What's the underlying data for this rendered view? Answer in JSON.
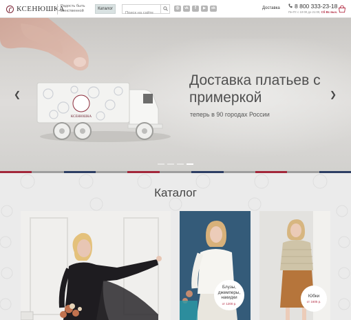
{
  "header": {
    "logo_text": "КСЕНЮШКА",
    "tagline": "Радость быть женственной",
    "catalog_label": "Каталог",
    "search_placeholder": "Поиск на сайте",
    "socials": [
      {
        "icon": "instagram-icon",
        "glyph": "◎"
      },
      {
        "icon": "vk-icon",
        "glyph": "vk"
      },
      {
        "icon": "facebook-icon",
        "glyph": "f"
      },
      {
        "icon": "youtube-icon",
        "glyph": "▶"
      },
      {
        "icon": "odnoklassniki-icon",
        "glyph": "ok"
      }
    ],
    "delivery_label": "Доставка",
    "phone": "8 800 333-23-18",
    "hours": "Пн-Пт с 10:00 до 21:00,",
    "dayoff": "Сб Вс вых."
  },
  "banner": {
    "title": "Доставка платьев с примеркой",
    "subtitle": "теперь в 90 городах России",
    "slide_count": 4,
    "active_slide": 4
  },
  "stripe_colors": [
    "#a2263a",
    "#9e9e9e",
    "#2d3e63",
    "#9e9e9e",
    "#a2263a",
    "#9e9e9e",
    "#2d3e63",
    "#9e9e9e",
    "#a2263a",
    "#9e9e9e",
    "#2d3e63"
  ],
  "catalog": {
    "title": "Каталог",
    "cards": [
      {
        "name": "",
        "price": ""
      },
      {
        "name": "Блузы, джемперы, накидки",
        "price": "от 1200 р."
      },
      {
        "name": "Юбки",
        "price": "от 1605 р."
      }
    ]
  },
  "colors": {
    "accent": "#b32d44",
    "catalog_button": "#d9e2e2"
  }
}
